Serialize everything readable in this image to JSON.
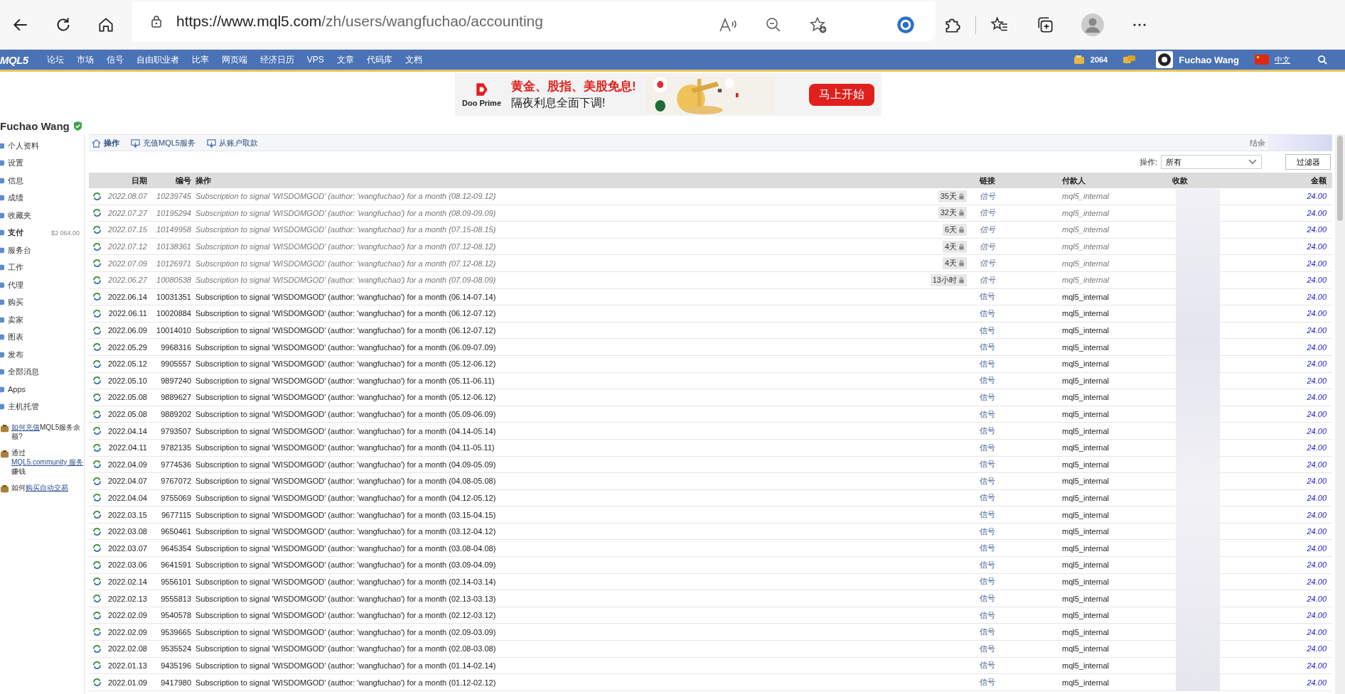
{
  "browser": {
    "url_host": "https://www.mql5.com",
    "url_path": "/zh/users/wangfuchao/accounting"
  },
  "nav": {
    "logo": "MQL5",
    "items": [
      "论坛",
      "市场",
      "信号",
      "自由职业者",
      "比率",
      "网页端",
      "经济日历",
      "VPS",
      "文章",
      "代码库",
      "文档"
    ],
    "balance": "2064",
    "user": "Fuchao Wang",
    "language": "中文"
  },
  "banner": {
    "brand": "Doo Prime",
    "headline": "黄金、股指、美股免息!",
    "subline": "隔夜利息全面下调!",
    "button": "马上开始"
  },
  "profile": {
    "name": "Fuchao Wang"
  },
  "sidebar": {
    "items": [
      {
        "label": "个人资料",
        "selected": false
      },
      {
        "label": "设置",
        "selected": false
      },
      {
        "label": "信息",
        "selected": false
      },
      {
        "label": "成绩",
        "selected": false
      },
      {
        "label": "收藏夹",
        "selected": false
      },
      {
        "label": "支付",
        "selected": true,
        "amount": "$2 064.00"
      },
      {
        "label": "服务台",
        "selected": false
      },
      {
        "label": "工作",
        "selected": false
      },
      {
        "label": "代理",
        "selected": false
      },
      {
        "label": "购买",
        "selected": false
      },
      {
        "label": "卖家",
        "selected": false
      },
      {
        "label": "图表",
        "selected": false
      },
      {
        "label": "发布",
        "selected": false
      },
      {
        "label": "全部消息",
        "selected": false
      },
      {
        "label": "Apps",
        "selected": false
      },
      {
        "label": "主机托管",
        "selected": false
      }
    ],
    "help_links": [
      [
        {
          "text": "如何充值",
          "link": true
        },
        {
          "text": "MQL5服务余额?",
          "link": false
        }
      ],
      [
        {
          "text": "通过",
          "link": false
        },
        {
          "text": "MQL5.community 服务",
          "link": true
        },
        {
          "text": "赚钱",
          "link": false
        }
      ],
      [
        {
          "text": "如何",
          "link": false
        },
        {
          "text": "购买自动交易",
          "link": true
        }
      ]
    ]
  },
  "tabs": [
    {
      "label": "操作",
      "selected": true
    },
    {
      "label": "充值MQL5服务",
      "selected": false
    },
    {
      "label": "从账户取款",
      "selected": false
    }
  ],
  "balance_label": "结余",
  "filter": {
    "label": "操作:",
    "value": "所有",
    "button": "过滤器"
  },
  "table": {
    "columns": [
      "日期",
      "编号",
      "操作",
      "链接",
      "付款人",
      "收款",
      "金额"
    ],
    "rows": [
      {
        "date": "2022.08.07",
        "id": "10239745",
        "operation": "Subscription to signal 'WISDOMGOD' (author: 'wangfuchao') for a month (08.12-09.12)",
        "pending": true,
        "badge": "35天",
        "link": "信号",
        "payer": "mql5_internal",
        "amount": "24.00"
      },
      {
        "date": "2022.07.27",
        "id": "10195294",
        "operation": "Subscription to signal 'WISDOMGOD' (author: 'wangfuchao') for a month (08.09-09.09)",
        "pending": true,
        "badge": "32天",
        "link": "信号",
        "payer": "mql5_internal",
        "amount": "24.00"
      },
      {
        "date": "2022.07.15",
        "id": "10149958",
        "operation": "Subscription to signal 'WISDOMGOD' (author: 'wangfuchao') for a month (07.15-08.15)",
        "pending": true,
        "badge": "6天",
        "link": "信号",
        "payer": "mql5_internal",
        "amount": "24.00"
      },
      {
        "date": "2022.07.12",
        "id": "10138361",
        "operation": "Subscription to signal 'WISDOMGOD' (author: 'wangfuchao') for a month (07.12-08.12)",
        "pending": true,
        "badge": "4天",
        "link": "信号",
        "payer": "mql5_internal",
        "amount": "24.00"
      },
      {
        "date": "2022.07.09",
        "id": "10126971",
        "operation": "Subscription to signal 'WISDOMGOD' (author: 'wangfuchao') for a month (07.12-08.12)",
        "pending": true,
        "badge": "4天",
        "link": "信号",
        "payer": "mql5_internal",
        "amount": "24.00"
      },
      {
        "date": "2022.06.27",
        "id": "10080538",
        "operation": "Subscription to signal 'WISDOMGOD' (author: 'wangfuchao') for a month (07.09-08.09)",
        "pending": true,
        "badge": "13小时",
        "link": "信号",
        "payer": "mql5_internal",
        "amount": "24.00"
      },
      {
        "date": "2022.06.14",
        "id": "10031351",
        "operation": "Subscription to signal 'WISDOMGOD' (author: 'wangfuchao') for a month (06.14-07.14)",
        "pending": false,
        "link": "信号",
        "payer": "mql5_internal",
        "amount": "24.00"
      },
      {
        "date": "2022.06.11",
        "id": "10020884",
        "operation": "Subscription to signal 'WISDOMGOD' (author: 'wangfuchao') for a month (06.12-07.12)",
        "pending": false,
        "link": "信号",
        "payer": "mql5_internal",
        "amount": "24.00"
      },
      {
        "date": "2022.06.09",
        "id": "10014010",
        "operation": "Subscription to signal 'WISDOMGOD' (author: 'wangfuchao') for a month (06.12-07.12)",
        "pending": false,
        "link": "信号",
        "payer": "mql5_internal",
        "amount": "24.00"
      },
      {
        "date": "2022.05.29",
        "id": "9968316",
        "operation": "Subscription to signal 'WISDOMGOD' (author: 'wangfuchao') for a month (06.09-07.09)",
        "pending": false,
        "link": "信号",
        "payer": "mql5_internal",
        "amount": "24.00"
      },
      {
        "date": "2022.05.12",
        "id": "9905557",
        "operation": "Subscription to signal 'WISDOMGOD' (author: 'wangfuchao') for a month (05.12-06.12)",
        "pending": false,
        "link": "信号",
        "payer": "mql5_internal",
        "amount": "24.00"
      },
      {
        "date": "2022.05.10",
        "id": "9897240",
        "operation": "Subscription to signal 'WISDOMGOD' (author: 'wangfuchao') for a month (05.11-06.11)",
        "pending": false,
        "link": "信号",
        "payer": "mql5_internal",
        "amount": "24.00"
      },
      {
        "date": "2022.05.08",
        "id": "9889627",
        "operation": "Subscription to signal 'WISDOMGOD' (author: 'wangfuchao') for a month (05.12-06.12)",
        "pending": false,
        "link": "信号",
        "payer": "mql5_internal",
        "amount": "24.00"
      },
      {
        "date": "2022.05.08",
        "id": "9889202",
        "operation": "Subscription to signal 'WISDOMGOD' (author: 'wangfuchao') for a month (05.09-06.09)",
        "pending": false,
        "link": "信号",
        "payer": "mql5_internal",
        "amount": "24.00"
      },
      {
        "date": "2022.04.14",
        "id": "9793507",
        "operation": "Subscription to signal 'WISDOMGOD' (author: 'wangfuchao') for a month (04.14-05.14)",
        "pending": false,
        "link": "信号",
        "payer": "mql5_internal",
        "amount": "24.00"
      },
      {
        "date": "2022.04.11",
        "id": "9782135",
        "operation": "Subscription to signal 'WISDOMGOD' (author: 'wangfuchao') for a month (04.11-05.11)",
        "pending": false,
        "link": "信号",
        "payer": "mql5_internal",
        "amount": "24.00"
      },
      {
        "date": "2022.04.09",
        "id": "9774536",
        "operation": "Subscription to signal 'WISDOMGOD' (author: 'wangfuchao') for a month (04.09-05.09)",
        "pending": false,
        "link": "信号",
        "payer": "mql5_internal",
        "amount": "24.00"
      },
      {
        "date": "2022.04.07",
        "id": "9767072",
        "operation": "Subscription to signal 'WISDOMGOD' (author: 'wangfuchao') for a month (04.08-05.08)",
        "pending": false,
        "link": "信号",
        "payer": "mql5_internal",
        "amount": "24.00"
      },
      {
        "date": "2022.04.04",
        "id": "9755069",
        "operation": "Subscription to signal 'WISDOMGOD' (author: 'wangfuchao') for a month (04.12-05.12)",
        "pending": false,
        "link": "信号",
        "payer": "mql5_internal",
        "amount": "24.00"
      },
      {
        "date": "2022.03.15",
        "id": "9677115",
        "operation": "Subscription to signal 'WISDOMGOD' (author: 'wangfuchao') for a month (03.15-04.15)",
        "pending": false,
        "link": "信号",
        "payer": "mql5_internal",
        "amount": "24.00"
      },
      {
        "date": "2022.03.08",
        "id": "9650461",
        "operation": "Subscription to signal 'WISDOMGOD' (author: 'wangfuchao') for a month (03.12-04.12)",
        "pending": false,
        "link": "信号",
        "payer": "mql5_internal",
        "amount": "24.00"
      },
      {
        "date": "2022.03.07",
        "id": "9645354",
        "operation": "Subscription to signal 'WISDOMGOD' (author: 'wangfuchao') for a month (03.08-04.08)",
        "pending": false,
        "link": "信号",
        "payer": "mql5_internal",
        "amount": "24.00"
      },
      {
        "date": "2022.03.06",
        "id": "9641591",
        "operation": "Subscription to signal 'WISDOMGOD' (author: 'wangfuchao') for a month (03.09-04.09)",
        "pending": false,
        "link": "信号",
        "payer": "mql5_internal",
        "amount": "24.00"
      },
      {
        "date": "2022.02.14",
        "id": "9556101",
        "operation": "Subscription to signal 'WISDOMGOD' (author: 'wangfuchao') for a month (02.14-03.14)",
        "pending": false,
        "link": "信号",
        "payer": "mql5_internal",
        "amount": "24.00"
      },
      {
        "date": "2022.02.13",
        "id": "9555813",
        "operation": "Subscription to signal 'WISDOMGOD' (author: 'wangfuchao') for a month (02.13-03.13)",
        "pending": false,
        "link": "信号",
        "payer": "mql5_internal",
        "amount": "24.00"
      },
      {
        "date": "2022.02.09",
        "id": "9540578",
        "operation": "Subscription to signal 'WISDOMGOD' (author: 'wangfuchao') for a month (02.12-03.12)",
        "pending": false,
        "link": "信号",
        "payer": "mql5_internal",
        "amount": "24.00"
      },
      {
        "date": "2022.02.09",
        "id": "9539665",
        "operation": "Subscription to signal 'WISDOMGOD' (author: 'wangfuchao') for a month (02.09-03.09)",
        "pending": false,
        "link": "信号",
        "payer": "mql5_internal",
        "amount": "24.00"
      },
      {
        "date": "2022.02.08",
        "id": "9535524",
        "operation": "Subscription to signal 'WISDOMGOD' (author: 'wangfuchao') for a month (02.08-03.08)",
        "pending": false,
        "link": "信号",
        "payer": "mql5_internal",
        "amount": "24.00"
      },
      {
        "date": "2022.01.13",
        "id": "9435196",
        "operation": "Subscription to signal 'WISDOMGOD' (author: 'wangfuchao') for a month (01.14-02.14)",
        "pending": false,
        "link": "信号",
        "payer": "mql5_internal",
        "amount": "24.00"
      },
      {
        "date": "2022.01.09",
        "id": "9417980",
        "operation": "Subscription to signal 'WISDOMGOD' (author: 'wangfuchao') for a month (01.12-02.12)",
        "pending": false,
        "link": "信号",
        "payer": "mql5_internal",
        "amount": "24.00"
      }
    ]
  }
}
